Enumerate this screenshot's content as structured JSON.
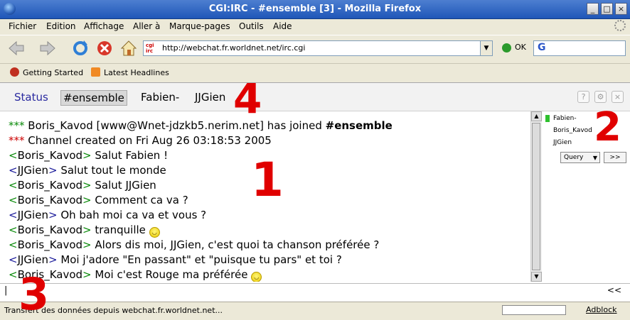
{
  "window": {
    "title": "CGI:IRC - #ensemble [3]  - Mozilla Firefox"
  },
  "menu": [
    "Fichier",
    "Edition",
    "Affichage",
    "Aller à",
    "Marque-pages",
    "Outils",
    "Aide"
  ],
  "nav": {
    "url": "http://webchat.fr.worldnet.net/irc.cgi",
    "ok_label": "OK",
    "favicon_text": "cgi irc",
    "search_icon": "G"
  },
  "bookmarks": [
    {
      "label": "Getting Started",
      "icon": "firefox-icon"
    },
    {
      "label": "Latest Headlines",
      "icon": "rss-icon"
    }
  ],
  "tabs": [
    "Status",
    "#ensemble",
    "Fabien-",
    "JJGien"
  ],
  "active_tab": "#ensemble",
  "log": [
    {
      "prefix": "***",
      "nick": "",
      "text": "Boris_Kavod [www@Wnet-jdzkb5.nerim.net] has joined ",
      "bold": "#ensemble",
      "smile": false
    },
    {
      "prefix": "***",
      "nick": "",
      "text": "Channel created on Fri Aug 26 03:18:53 2005",
      "bold": "",
      "smile": false
    },
    {
      "prefix": "",
      "nick": "Boris_Kavod",
      "text": "Salut Fabien !",
      "bold": "",
      "smile": false
    },
    {
      "prefix": "",
      "nick": "JJGien",
      "text": "Salut tout le monde",
      "bold": "",
      "smile": false
    },
    {
      "prefix": "",
      "nick": "Boris_Kavod",
      "text": "Salut JJGien",
      "bold": "",
      "smile": false
    },
    {
      "prefix": "",
      "nick": "Boris_Kavod",
      "text": "Comment ca va ?",
      "bold": "",
      "smile": false
    },
    {
      "prefix": "",
      "nick": "JJGien",
      "text": "Oh bah moi ca va et vous ?",
      "bold": "",
      "smile": false
    },
    {
      "prefix": "",
      "nick": "Boris_Kavod",
      "text": "tranquille",
      "bold": "",
      "smile": true
    },
    {
      "prefix": "",
      "nick": "Boris_Kavod",
      "text": "Alors dis moi, JJGien, c'est quoi ta chanson préférée ?",
      "bold": "",
      "smile": false
    },
    {
      "prefix": "",
      "nick": "JJGien",
      "text": "Moi j'adore \"En passant\" et \"puisque tu pars\" et toi ?",
      "bold": "",
      "smile": false
    },
    {
      "prefix": "",
      "nick": "Boris_Kavod",
      "text": "Moi c'est Rouge ma préférée",
      "bold": "",
      "smile": true
    }
  ],
  "nicklist": [
    "Fabien-",
    "Boris_Kavod",
    "JJGien"
  ],
  "query": {
    "select": "Query",
    "go": ">>"
  },
  "input": {
    "value": "|",
    "toggle": "<<"
  },
  "status": {
    "text": "Transfert des données depuis webchat.fr.worldnet.net...",
    "adblock": "Adblock"
  },
  "annotations": [
    "1",
    "2",
    "3",
    "4"
  ],
  "colors": {
    "titlebar": "#1f56b8",
    "join_star": "#0a8a0a",
    "part_star": "#c00000",
    "nick_green": "#0a8a0a",
    "nick_blue": "#1a1a9a",
    "annotation": "#e00000"
  }
}
